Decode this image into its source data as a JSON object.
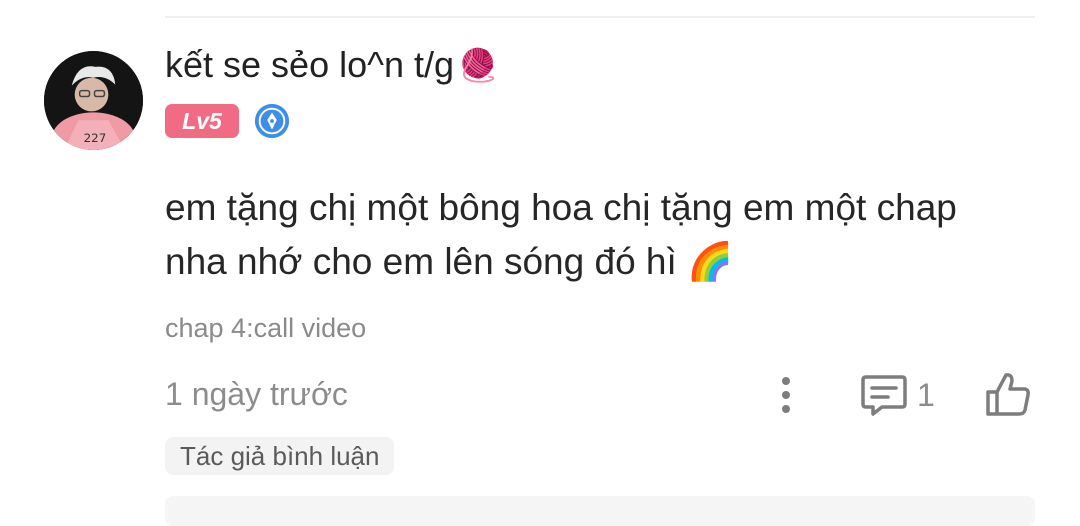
{
  "comment": {
    "username": "kết se sẻo lo^n t/g",
    "username_emoji": "🧶",
    "level_label": "Lv5",
    "text": "em tặng chị một bông hoa chị tặng em một chap nha nhớ cho em lên sóng đó hì",
    "text_emoji": "🌈",
    "chapter_ref": "chap 4:call video",
    "timestamp": "1 ngày trước",
    "reply_count": "1",
    "author_tag": "Tác giả bình luận"
  },
  "icons": {
    "avatar": "user-avatar-photo",
    "medal": "author-medal-icon",
    "more": "more-vertical-icon",
    "reply": "comment-bubble-icon",
    "like": "thumbs-up-icon"
  },
  "colors": {
    "level_badge": "#f26b85",
    "medal_blue": "#3d8ee8",
    "muted_text": "#8c8c8c"
  }
}
